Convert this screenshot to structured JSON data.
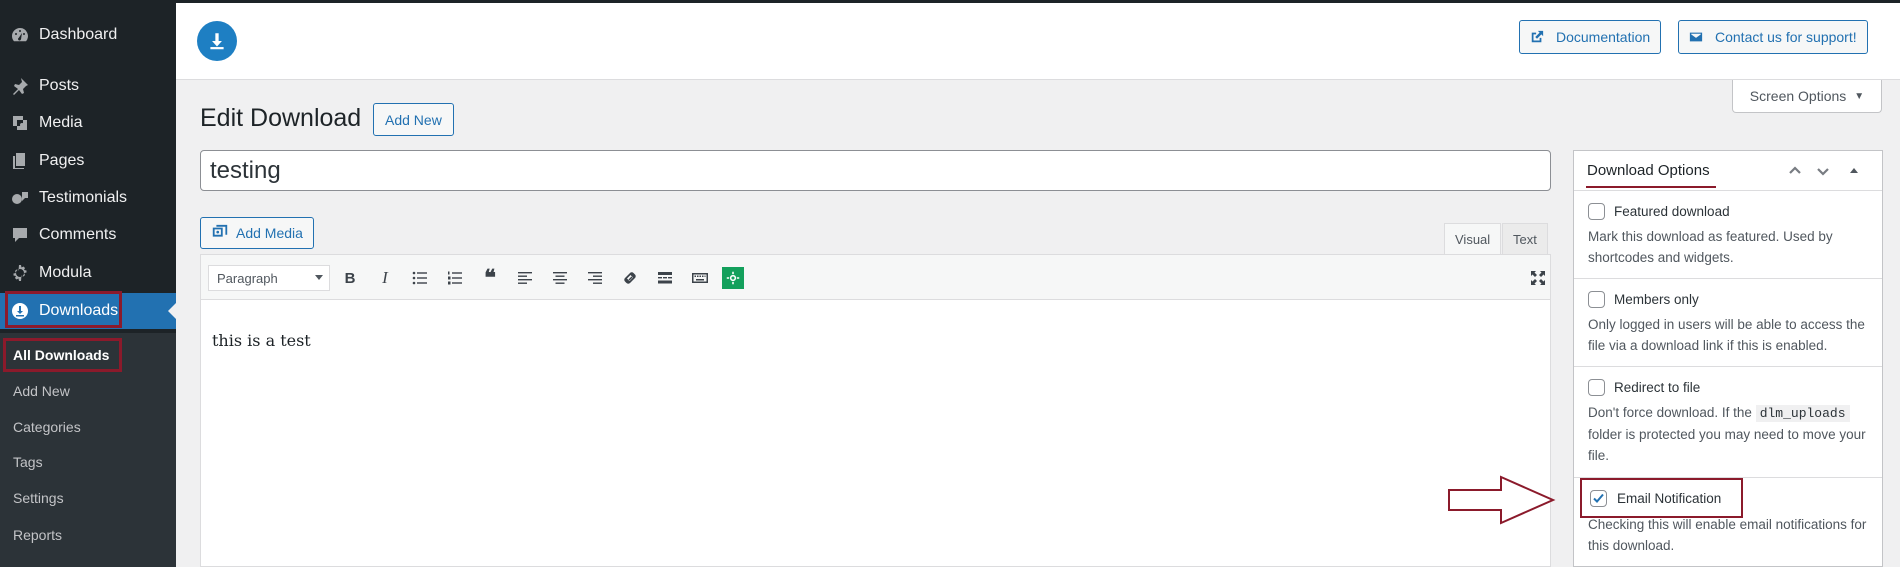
{
  "sidebar": {
    "items": [
      {
        "label": "Dashboard",
        "icon": "dashboard-icon"
      },
      {
        "label": "Posts",
        "icon": "pin-icon"
      },
      {
        "label": "Media",
        "icon": "media-icon"
      },
      {
        "label": "Pages",
        "icon": "pages-icon"
      },
      {
        "label": "Testimonials",
        "icon": "testimonials-icon"
      },
      {
        "label": "Comments",
        "icon": "comment-icon"
      },
      {
        "label": "Modula",
        "icon": "gear-icon"
      },
      {
        "label": "Downloads",
        "icon": "download-icon"
      }
    ],
    "submenu": [
      "All Downloads",
      "Add New",
      "Categories",
      "Tags",
      "Settings",
      "Reports"
    ]
  },
  "header": {
    "documentation_label": "Documentation",
    "support_label": "Contact us for support!"
  },
  "screen_options_label": "Screen Options",
  "page": {
    "title": "Edit Download",
    "add_new_label": "Add New",
    "post_title": "testing"
  },
  "editor": {
    "add_media_label": "Add Media",
    "tab_visual": "Visual",
    "tab_text": "Text",
    "format_value": "Paragraph",
    "content": "this is a test"
  },
  "download_options": {
    "title": "Download Options",
    "options": [
      {
        "label": "Featured download",
        "desc": "Mark this download as featured. Used by shortcodes and widgets.",
        "checked": false
      },
      {
        "label": "Members only",
        "desc": "Only logged in users will be able to access the file via a download link if this is enabled.",
        "checked": false
      },
      {
        "label": "Redirect to file",
        "desc_pre": "Don't force download. If the",
        "desc_code": "dlm_uploads",
        "desc_post": "folder is protected you may need to move your file.",
        "checked": false
      },
      {
        "label": "Email Notification",
        "desc": "Checking this will enable email notifications for this download.",
        "checked": true
      }
    ]
  },
  "colors": {
    "accent": "#2271b1",
    "sidebar_bg": "#1d2327",
    "highlight": "#8b1a2b"
  }
}
